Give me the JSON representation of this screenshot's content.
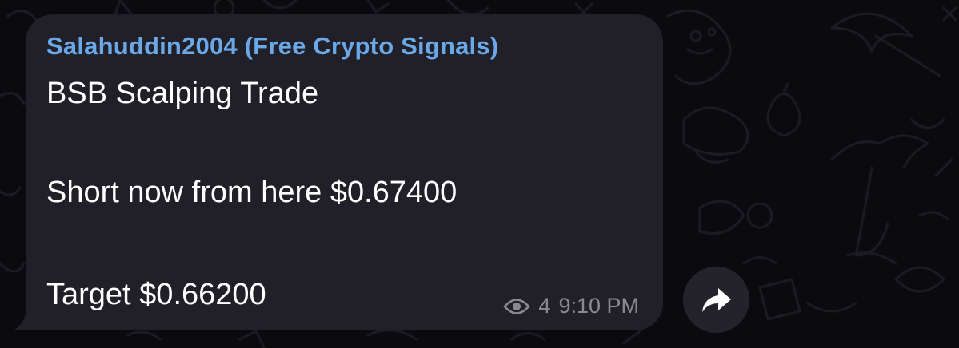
{
  "message": {
    "sender": "Salahuddin2004 (Free Crypto Signals)",
    "lines": [
      "BSB Scalping Trade",
      "Short now from here $0.67400",
      "Target $0.66200"
    ],
    "views": "4",
    "time": "9:10 PM"
  },
  "icons": {
    "views": "eye-icon",
    "forward": "forward-arrow-icon"
  },
  "colors": {
    "background": "#0b0b0f",
    "bubble": "#212029",
    "sender": "#6aa8e8",
    "text": "#ffffff",
    "meta": "#8b8a93"
  }
}
